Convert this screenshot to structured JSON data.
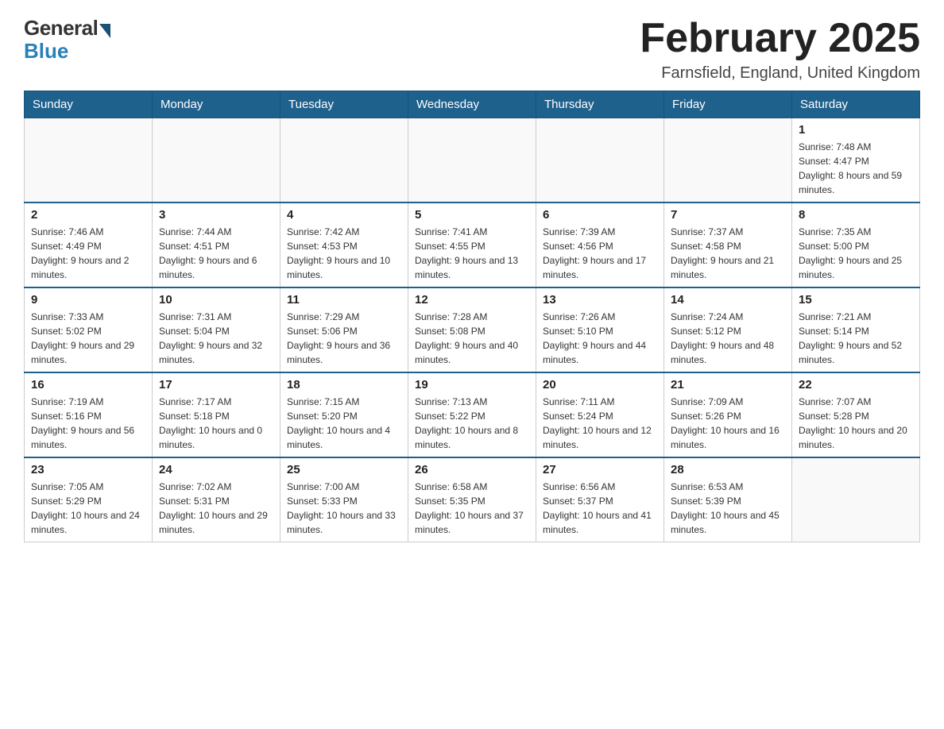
{
  "logo": {
    "general": "General",
    "blue": "Blue"
  },
  "title": "February 2025",
  "location": "Farnsfield, England, United Kingdom",
  "weekdays": [
    "Sunday",
    "Monday",
    "Tuesday",
    "Wednesday",
    "Thursday",
    "Friday",
    "Saturday"
  ],
  "weeks": [
    [
      {
        "day": "",
        "info": ""
      },
      {
        "day": "",
        "info": ""
      },
      {
        "day": "",
        "info": ""
      },
      {
        "day": "",
        "info": ""
      },
      {
        "day": "",
        "info": ""
      },
      {
        "day": "",
        "info": ""
      },
      {
        "day": "1",
        "info": "Sunrise: 7:48 AM\nSunset: 4:47 PM\nDaylight: 8 hours and 59 minutes."
      }
    ],
    [
      {
        "day": "2",
        "info": "Sunrise: 7:46 AM\nSunset: 4:49 PM\nDaylight: 9 hours and 2 minutes."
      },
      {
        "day": "3",
        "info": "Sunrise: 7:44 AM\nSunset: 4:51 PM\nDaylight: 9 hours and 6 minutes."
      },
      {
        "day": "4",
        "info": "Sunrise: 7:42 AM\nSunset: 4:53 PM\nDaylight: 9 hours and 10 minutes."
      },
      {
        "day": "5",
        "info": "Sunrise: 7:41 AM\nSunset: 4:55 PM\nDaylight: 9 hours and 13 minutes."
      },
      {
        "day": "6",
        "info": "Sunrise: 7:39 AM\nSunset: 4:56 PM\nDaylight: 9 hours and 17 minutes."
      },
      {
        "day": "7",
        "info": "Sunrise: 7:37 AM\nSunset: 4:58 PM\nDaylight: 9 hours and 21 minutes."
      },
      {
        "day": "8",
        "info": "Sunrise: 7:35 AM\nSunset: 5:00 PM\nDaylight: 9 hours and 25 minutes."
      }
    ],
    [
      {
        "day": "9",
        "info": "Sunrise: 7:33 AM\nSunset: 5:02 PM\nDaylight: 9 hours and 29 minutes."
      },
      {
        "day": "10",
        "info": "Sunrise: 7:31 AM\nSunset: 5:04 PM\nDaylight: 9 hours and 32 minutes."
      },
      {
        "day": "11",
        "info": "Sunrise: 7:29 AM\nSunset: 5:06 PM\nDaylight: 9 hours and 36 minutes."
      },
      {
        "day": "12",
        "info": "Sunrise: 7:28 AM\nSunset: 5:08 PM\nDaylight: 9 hours and 40 minutes."
      },
      {
        "day": "13",
        "info": "Sunrise: 7:26 AM\nSunset: 5:10 PM\nDaylight: 9 hours and 44 minutes."
      },
      {
        "day": "14",
        "info": "Sunrise: 7:24 AM\nSunset: 5:12 PM\nDaylight: 9 hours and 48 minutes."
      },
      {
        "day": "15",
        "info": "Sunrise: 7:21 AM\nSunset: 5:14 PM\nDaylight: 9 hours and 52 minutes."
      }
    ],
    [
      {
        "day": "16",
        "info": "Sunrise: 7:19 AM\nSunset: 5:16 PM\nDaylight: 9 hours and 56 minutes."
      },
      {
        "day": "17",
        "info": "Sunrise: 7:17 AM\nSunset: 5:18 PM\nDaylight: 10 hours and 0 minutes."
      },
      {
        "day": "18",
        "info": "Sunrise: 7:15 AM\nSunset: 5:20 PM\nDaylight: 10 hours and 4 minutes."
      },
      {
        "day": "19",
        "info": "Sunrise: 7:13 AM\nSunset: 5:22 PM\nDaylight: 10 hours and 8 minutes."
      },
      {
        "day": "20",
        "info": "Sunrise: 7:11 AM\nSunset: 5:24 PM\nDaylight: 10 hours and 12 minutes."
      },
      {
        "day": "21",
        "info": "Sunrise: 7:09 AM\nSunset: 5:26 PM\nDaylight: 10 hours and 16 minutes."
      },
      {
        "day": "22",
        "info": "Sunrise: 7:07 AM\nSunset: 5:28 PM\nDaylight: 10 hours and 20 minutes."
      }
    ],
    [
      {
        "day": "23",
        "info": "Sunrise: 7:05 AM\nSunset: 5:29 PM\nDaylight: 10 hours and 24 minutes."
      },
      {
        "day": "24",
        "info": "Sunrise: 7:02 AM\nSunset: 5:31 PM\nDaylight: 10 hours and 29 minutes."
      },
      {
        "day": "25",
        "info": "Sunrise: 7:00 AM\nSunset: 5:33 PM\nDaylight: 10 hours and 33 minutes."
      },
      {
        "day": "26",
        "info": "Sunrise: 6:58 AM\nSunset: 5:35 PM\nDaylight: 10 hours and 37 minutes."
      },
      {
        "day": "27",
        "info": "Sunrise: 6:56 AM\nSunset: 5:37 PM\nDaylight: 10 hours and 41 minutes."
      },
      {
        "day": "28",
        "info": "Sunrise: 6:53 AM\nSunset: 5:39 PM\nDaylight: 10 hours and 45 minutes."
      },
      {
        "day": "",
        "info": ""
      }
    ]
  ]
}
